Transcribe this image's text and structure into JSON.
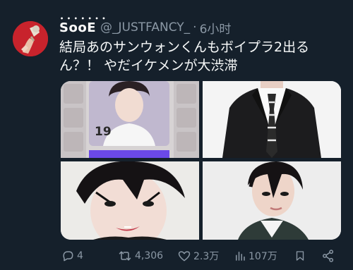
{
  "tweet": {
    "display_name": "SooE",
    "handle": "@_JUSTFANCY_",
    "separator": "·",
    "timestamp": "6小时",
    "text_lines": [
      "結局あのサンウォンくんもボイプラ2出る",
      "ん？！ やだイケメンが大渋滞"
    ]
  },
  "media": {
    "card_number": "19"
  },
  "actions": {
    "replies": "4",
    "retweets": "4,306",
    "likes": "2.3万",
    "views": "107万"
  },
  "icons": [
    "avatar",
    "reply-icon",
    "retweet-icon",
    "like-icon",
    "views-icon",
    "bookmark-icon",
    "share-icon"
  ],
  "colors": {
    "background": "#15202b",
    "text": "#f7f9f9",
    "secondary": "#8b98a5",
    "avatar_bg": "#c8232c",
    "card_purple": "#6b49e8"
  }
}
